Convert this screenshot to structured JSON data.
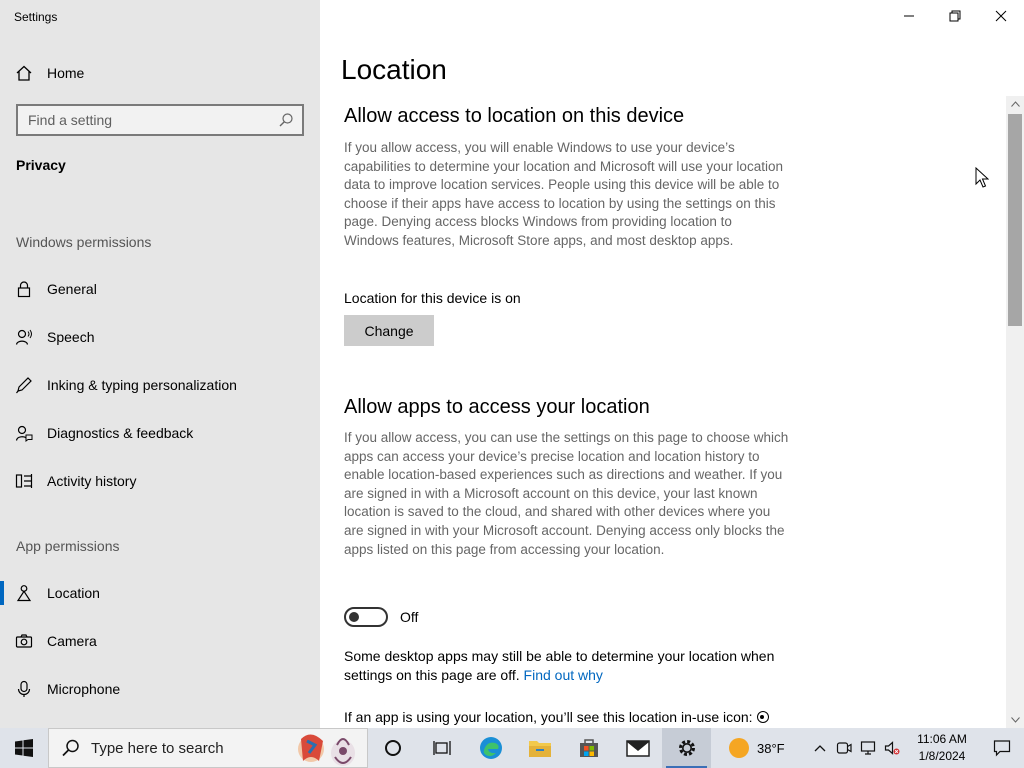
{
  "window": {
    "title": "Settings"
  },
  "sidebar": {
    "home_label": "Home",
    "search_placeholder": "Find a setting",
    "category": "Privacy",
    "windows_permissions_header": "Windows permissions",
    "windows_permissions": [
      {
        "label": "General",
        "icon": "lock-icon"
      },
      {
        "label": "Speech",
        "icon": "speech-icon"
      },
      {
        "label": "Inking & typing personalization",
        "icon": "inking-icon"
      },
      {
        "label": "Diagnostics & feedback",
        "icon": "diagnostics-icon"
      },
      {
        "label": "Activity history",
        "icon": "activity-history-icon"
      }
    ],
    "app_permissions_header": "App permissions",
    "app_permissions": [
      {
        "label": "Location",
        "icon": "location-icon",
        "selected": true
      },
      {
        "label": "Camera",
        "icon": "camera-icon"
      },
      {
        "label": "Microphone",
        "icon": "microphone-icon"
      }
    ]
  },
  "main": {
    "title": "Location",
    "section1": {
      "heading": "Allow access to location on this device",
      "description": "If you allow access, you will enable Windows to use your device’s capabilities to determine your location and Microsoft will use your location data to improve location services. People using this device will be able to choose if their apps have access to location by using the settings on this page. Denying access blocks Windows from providing location to Windows features, Microsoft Store apps, and most desktop apps.",
      "status": "Location for this device is on",
      "change_button": "Change"
    },
    "section2": {
      "heading": "Allow apps to access your location",
      "description": "If you allow access, you can use the settings on this page to choose which apps can access your device’s precise location and location history to enable location-based experiences such as directions and weather. If you are signed in with a Microsoft account on this device, your last known location is saved to the cloud, and shared with other devices where you are signed in with your Microsoft account. Denying access only blocks the apps listed on this page from accessing your location.",
      "toggle_state": "Off",
      "toggle_on": false,
      "desktop_note": "Some desktop apps may still be able to determine your location when settings on this page are off.",
      "find_out_link": "Find out why",
      "in_use_note": "If an app is using your location, you’ll see this location in-use icon:"
    }
  },
  "taskbar": {
    "search_placeholder": "Type here to search",
    "weather_temp": "38°F",
    "time": "11:06 AM",
    "date": "1/8/2024",
    "pinned": [
      "cortana-icon",
      "task-view-icon",
      "edge-icon",
      "file-explorer-icon",
      "store-icon",
      "mail-icon",
      "settings-icon"
    ]
  },
  "colors": {
    "accent": "#0067c0",
    "sidebar_bg": "#e6e6e6",
    "taskbar_bg": "#dfe3ea"
  }
}
